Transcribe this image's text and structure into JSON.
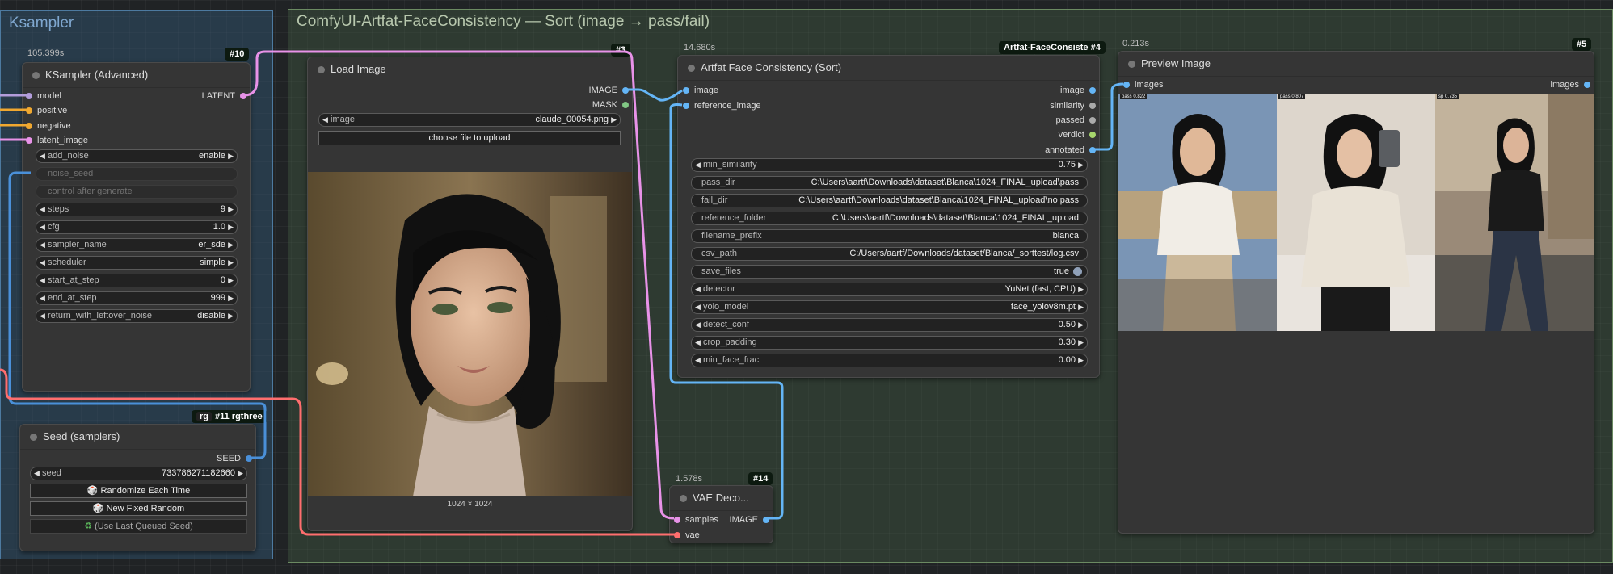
{
  "groups": {
    "ksampler": "Ksampler",
    "facecons": "ComfyUI-Artfat-FaceConsistency — Sort (image → pass/fail)"
  },
  "ksampler_node": {
    "timing": "105.399s",
    "badge": "#10",
    "title": "KSampler (Advanced)",
    "inputs": [
      "model",
      "positive",
      "negative",
      "latent_image"
    ],
    "output": "LATENT",
    "widgets": [
      {
        "label": "add_noise",
        "value": "enable"
      },
      {
        "label": "noise_seed",
        "value": ""
      },
      {
        "label": "control after generate",
        "value": ""
      },
      {
        "label": "steps",
        "value": "9"
      },
      {
        "label": "cfg",
        "value": "1.0"
      },
      {
        "label": "sampler_name",
        "value": "er_sde"
      },
      {
        "label": "scheduler",
        "value": "simple"
      },
      {
        "label": "start_at_step",
        "value": "0"
      },
      {
        "label": "end_at_step",
        "value": "999"
      },
      {
        "label": "return_with_leftover_noise",
        "value": "disable"
      }
    ]
  },
  "seed_node": {
    "badge_tag": "rg",
    "badge": "#11 rgthree",
    "title": "Seed (samplers)",
    "output": "SEED",
    "seed_label": "seed",
    "seed_value": "733786271182660",
    "btn_randomize": "Randomize Each Time",
    "btn_new": "New Fixed Random",
    "btn_last": "(Use Last Queued Seed)"
  },
  "load_image_node": {
    "badge": "#3",
    "title": "Load Image",
    "outputs": [
      "IMAGE",
      "MASK"
    ],
    "image_label": "image",
    "image_value": "claude_00054.png",
    "upload_btn": "choose file to upload",
    "image_size": "1024 × 1024"
  },
  "face_node": {
    "timing": "14.680s",
    "badge": "Artfat-FaceConsiste",
    "badge_num": "#4",
    "title": "Artfat Face Consistency (Sort)",
    "inputs": [
      "image",
      "reference_image"
    ],
    "outputs": [
      "image",
      "similarity",
      "passed",
      "verdict",
      "annotated"
    ],
    "widgets": [
      {
        "label": "min_similarity",
        "value": "0.75",
        "kind": "num"
      },
      {
        "label": "pass_dir",
        "value": "C:\\Users\\aartf\\Downloads\\dataset\\Blanca\\1024_FINAL_upload\\pass",
        "kind": "text"
      },
      {
        "label": "fail_dir",
        "value": "C:\\Users\\aartf\\Downloads\\dataset\\Blanca\\1024_FINAL_upload\\no pass",
        "kind": "text"
      },
      {
        "label": "reference_folder",
        "value": "C:\\Users\\aartf\\Downloads\\dataset\\Blanca\\1024_FINAL_upload",
        "kind": "text"
      },
      {
        "label": "filename_prefix",
        "value": "blanca",
        "kind": "text"
      },
      {
        "label": "csv_path",
        "value": "C:/Users/aartf/Downloads/dataset/Blanca/_sorttest/log.csv",
        "kind": "text"
      },
      {
        "label": "save_files",
        "value": "true",
        "kind": "toggle"
      },
      {
        "label": "detector",
        "value": "YuNet (fast, CPU)",
        "kind": "num"
      },
      {
        "label": "yolo_model",
        "value": "face_yolov8m.pt",
        "kind": "num"
      },
      {
        "label": "detect_conf",
        "value": "0.50",
        "kind": "num"
      },
      {
        "label": "crop_padding",
        "value": "0.30",
        "kind": "num"
      },
      {
        "label": "min_face_frac",
        "value": "0.00",
        "kind": "num"
      }
    ]
  },
  "vae_node": {
    "timing": "1.578s",
    "badge": "#14",
    "title": "VAE Deco...",
    "inputs": [
      "samples",
      "vae"
    ],
    "output": "IMAGE"
  },
  "preview_node": {
    "timing": "0.213s",
    "badge": "#5",
    "title": "Preview Image",
    "input": "images",
    "output": "images",
    "thumb_labels": [
      "pass 0.822",
      "pass 0.807",
      "sp 0.735"
    ]
  },
  "colors": {
    "latent": "#e892e8",
    "model": "#b39ddb",
    "conditioning": "#f0a830",
    "image": "#64b5f6",
    "vae": "#ff6e6e",
    "mask": "#81c784",
    "seed": "#4a90d9",
    "float": "#aaaaaa",
    "boolean": "#a6d66c"
  }
}
